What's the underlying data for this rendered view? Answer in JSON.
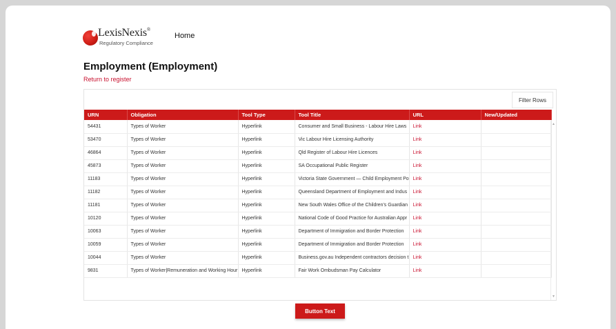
{
  "header": {
    "logo": {
      "name": "LexisNexis",
      "registered": "®",
      "subtitle": "Regulatory Compliance"
    },
    "nav_home": "Home"
  },
  "page": {
    "title": "Employment (Employment)",
    "return_link": "Return to register",
    "filter_rows": "Filter Rows",
    "button_text": "Button Text"
  },
  "table": {
    "columns": [
      "URN",
      "Obligation",
      "Tool Type",
      "Tool Title",
      "URL",
      "New/Updated"
    ],
    "rows": [
      {
        "urn": "54431",
        "obligation": "Types of Worker",
        "tool_type": "Hyperlink",
        "tool_title": "Consumer and Small Business - Labour Hire Laws",
        "url": "Link",
        "new_updated": ""
      },
      {
        "urn": "53470",
        "obligation": "Types of Worker",
        "tool_type": "Hyperlink",
        "tool_title": "Vic Labour Hire Licensing Authority",
        "url": "Link",
        "new_updated": ""
      },
      {
        "urn": "46864",
        "obligation": "Types of Worker",
        "tool_type": "Hyperlink",
        "tool_title": "Qld Register of Labour Hire Licences",
        "url": "Link",
        "new_updated": ""
      },
      {
        "urn": "45873",
        "obligation": "Types of Worker",
        "tool_type": "Hyperlink",
        "tool_title": "SA Occupational Public Register",
        "url": "Link",
        "new_updated": ""
      },
      {
        "urn": "11183",
        "obligation": "Types of Worker",
        "tool_type": "Hyperlink",
        "tool_title": "Victoria State Government — Child Employment Po",
        "url": "Link",
        "new_updated": ""
      },
      {
        "urn": "11182",
        "obligation": "Types of Worker",
        "tool_type": "Hyperlink",
        "tool_title": "Queensland Department of Employment and Indus",
        "url": "Link",
        "new_updated": ""
      },
      {
        "urn": "11181",
        "obligation": "Types of Worker",
        "tool_type": "Hyperlink",
        "tool_title": "New South Wales Office of the Children's Guardian",
        "url": "Link",
        "new_updated": ""
      },
      {
        "urn": "10120",
        "obligation": "Types of Worker",
        "tool_type": "Hyperlink",
        "tool_title": "National Code of Good Practice for Australian Appr",
        "url": "Link",
        "new_updated": ""
      },
      {
        "urn": "10063",
        "obligation": "Types of Worker",
        "tool_type": "Hyperlink",
        "tool_title": "Department of Immigration and Border Protection",
        "url": "Link",
        "new_updated": ""
      },
      {
        "urn": "10059",
        "obligation": "Types of Worker",
        "tool_type": "Hyperlink",
        "tool_title": "Department of Immigration and Border Protection",
        "url": "Link",
        "new_updated": ""
      },
      {
        "urn": "10044",
        "obligation": "Types of Worker",
        "tool_type": "Hyperlink",
        "tool_title": "Business.gov.au Independent contractors decision t",
        "url": "Link",
        "new_updated": ""
      },
      {
        "urn": "9831",
        "obligation": "Types of Worker|Remuneration and Working Hour",
        "tool_type": "Hyperlink",
        "tool_title": "Fair Work Ombudsman Pay Calculator",
        "url": "Link",
        "new_updated": ""
      }
    ]
  },
  "colors": {
    "brand_red": "#cc1a1a",
    "link_red": "#c8102e",
    "backdrop": "#d6d6d6"
  },
  "icons": {
    "logo": "lexisnexis-ball-icon",
    "scroll_up": "scroll-up-arrow-icon",
    "scroll_down": "scroll-down-arrow-icon"
  }
}
